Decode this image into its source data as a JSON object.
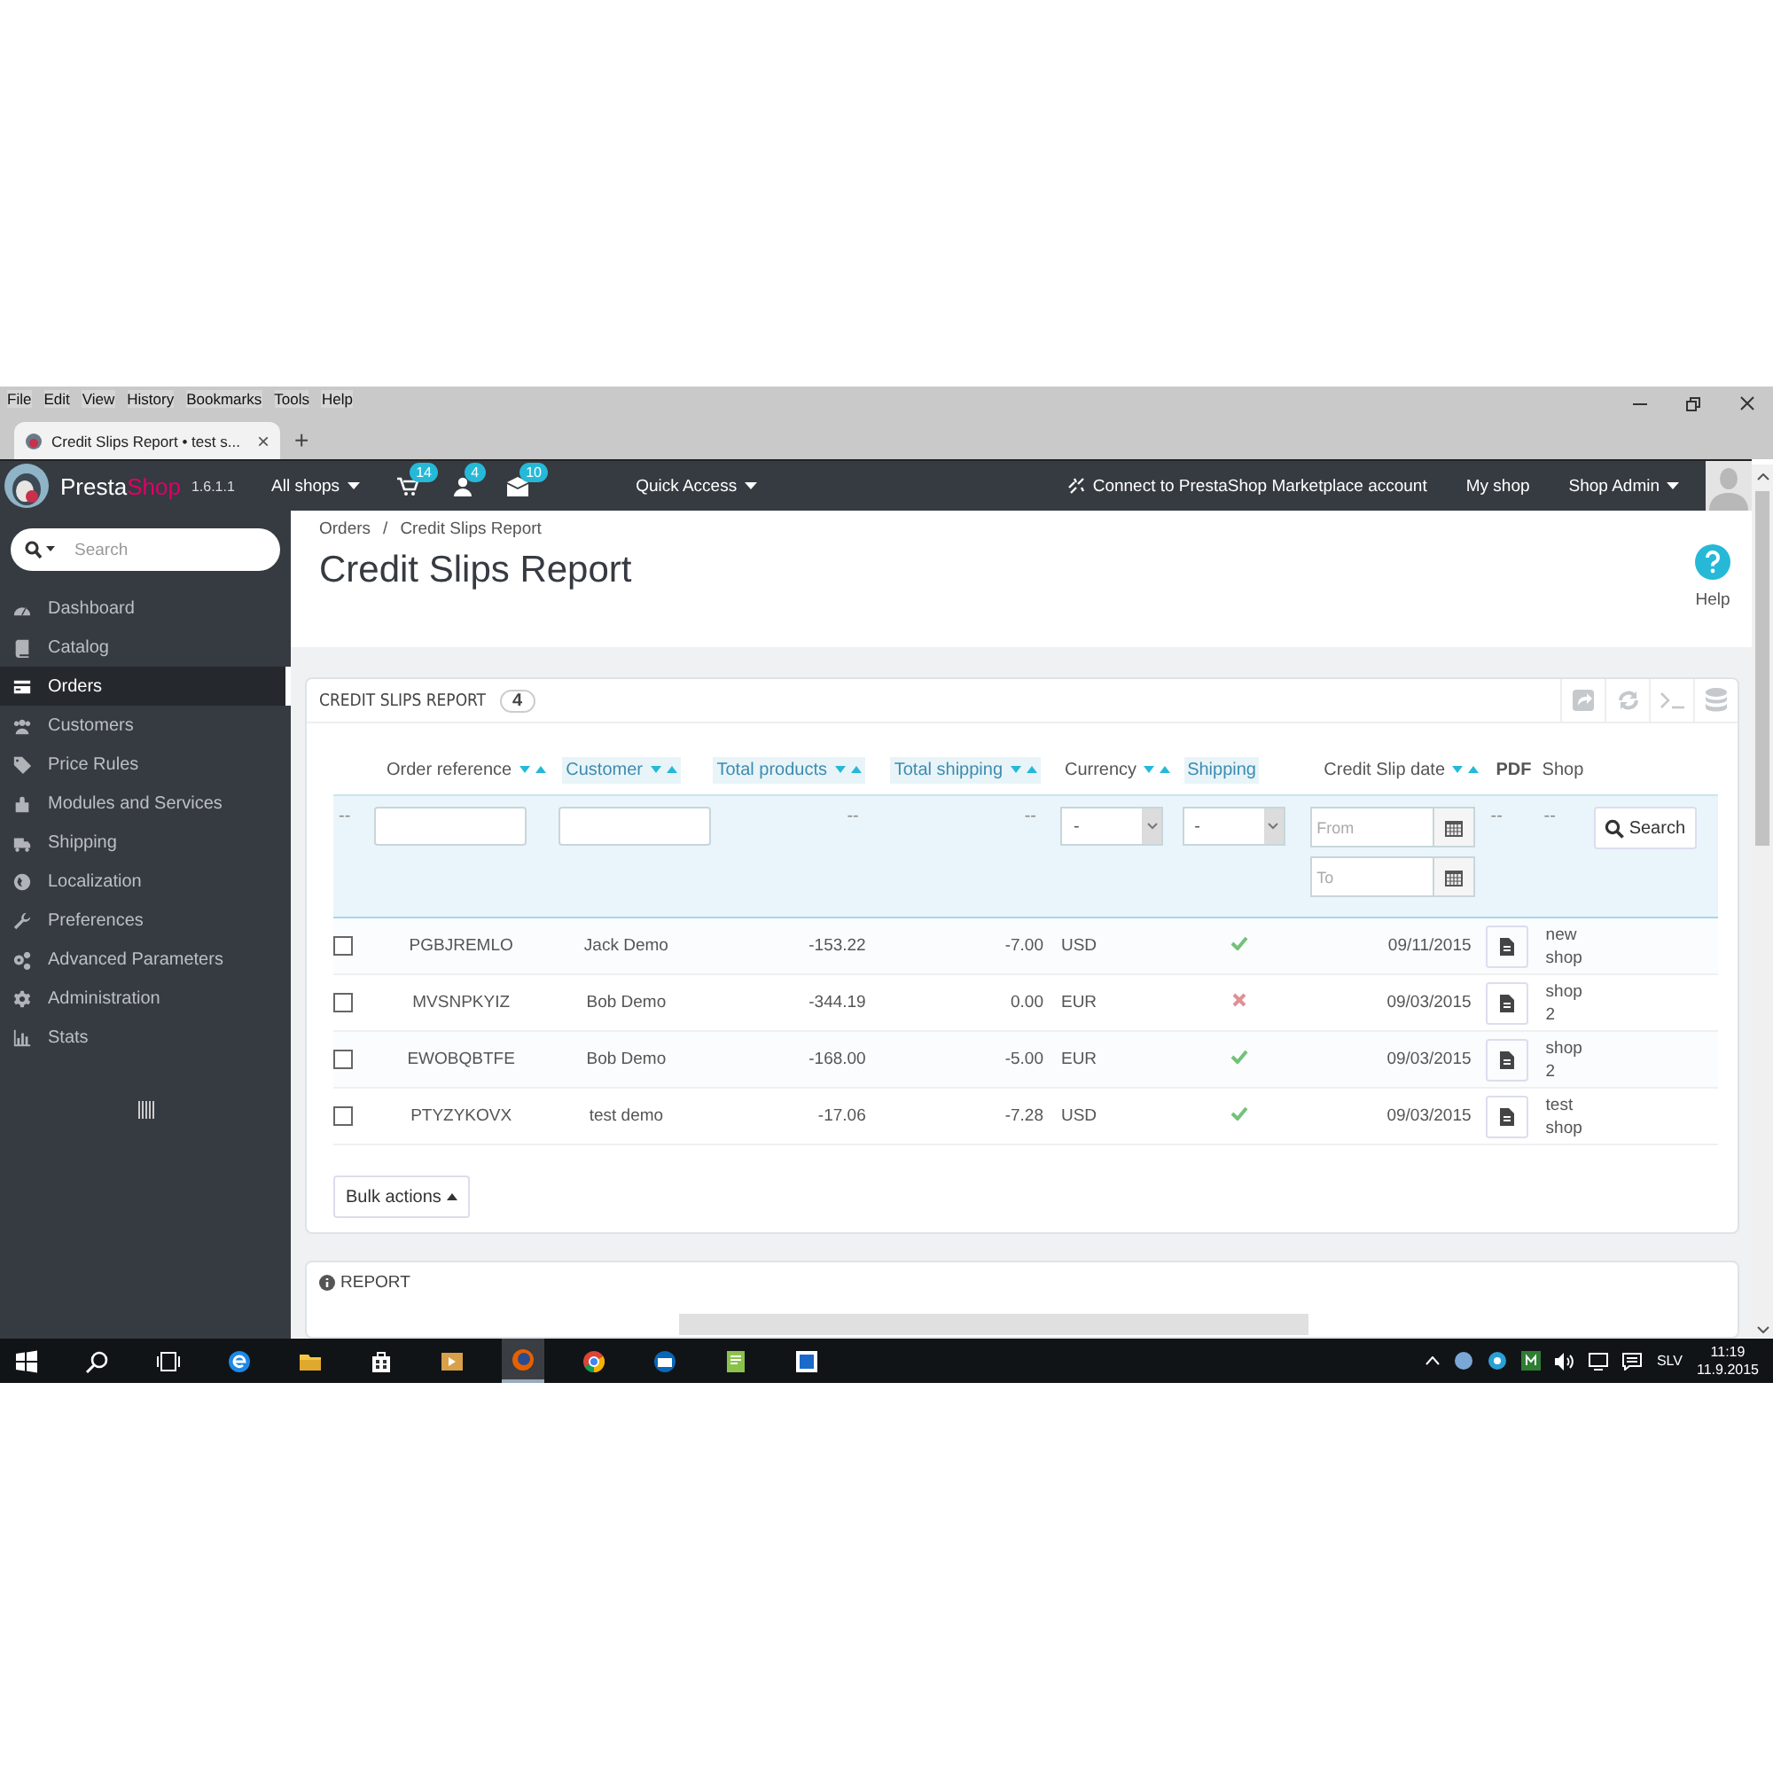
{
  "browser": {
    "menu": [
      "File",
      "Edit",
      "View",
      "History",
      "Bookmarks",
      "Tools",
      "Help"
    ],
    "tab": {
      "title": "Credit Slips Report • test s...",
      "close": "×"
    },
    "new_tab": "+"
  },
  "header": {
    "brand_a": "Presta",
    "brand_b": "Shop",
    "version": "1.6.1.1",
    "shop_selector": "All shops",
    "notifications": [
      {
        "kind": "cart",
        "count": "14"
      },
      {
        "kind": "customer",
        "count": "4"
      },
      {
        "kind": "message",
        "count": "10"
      }
    ],
    "quick_access": "Quick Access",
    "marketplace": "Connect to PrestaShop Marketplace account",
    "my_shop": "My shop",
    "user": "Shop Admin"
  },
  "sidebar": {
    "search_placeholder": "Search",
    "items": [
      {
        "label": "Dashboard",
        "kind": "dashboard",
        "selected": false
      },
      {
        "label": "Catalog",
        "kind": "catalog",
        "selected": false
      },
      {
        "label": "Orders",
        "kind": "orders",
        "selected": true
      },
      {
        "label": "Customers",
        "kind": "customers",
        "selected": false
      },
      {
        "label": "Price Rules",
        "kind": "price",
        "selected": false
      },
      {
        "label": "Modules and Services",
        "kind": "modules",
        "selected": false
      },
      {
        "label": "Shipping",
        "kind": "shipping",
        "selected": false
      },
      {
        "label": "Localization",
        "kind": "localization",
        "selected": false
      },
      {
        "label": "Preferences",
        "kind": "preferences",
        "selected": false
      },
      {
        "label": "Advanced Parameters",
        "kind": "advanced",
        "selected": false
      },
      {
        "label": "Administration",
        "kind": "administration",
        "selected": false
      },
      {
        "label": "Stats",
        "kind": "stats",
        "selected": false
      }
    ]
  },
  "page": {
    "breadcrumb": [
      "Orders",
      "Credit Slips Report"
    ],
    "separator": "/",
    "title": "Credit Slips Report",
    "help": "Help"
  },
  "panel": {
    "title": "CREDIT SLIPS REPORT",
    "count": "4",
    "columns": [
      {
        "label": "Order reference",
        "sortable": true,
        "highlighted": false,
        "bold": false
      },
      {
        "label": "Customer",
        "sortable": true,
        "highlighted": true,
        "bold": false
      },
      {
        "label": "Total products",
        "sortable": true,
        "highlighted": true,
        "bold": false
      },
      {
        "label": "Total shipping",
        "sortable": true,
        "highlighted": true,
        "bold": false
      },
      {
        "label": "Currency",
        "sortable": true,
        "highlighted": false,
        "bold": false
      },
      {
        "label": "Shipping",
        "sortable": false,
        "highlighted": true,
        "bold": false
      },
      {
        "label": "Credit Slip date",
        "sortable": true,
        "highlighted": false,
        "bold": false
      },
      {
        "label": "PDF",
        "sortable": false,
        "highlighted": false,
        "bold": true
      },
      {
        "label": "Shop",
        "sortable": false,
        "highlighted": false,
        "bold": false
      }
    ],
    "filters": [
      {
        "kind": "dash",
        "text": "--"
      },
      {
        "kind": "text"
      },
      {
        "kind": "text"
      },
      {
        "kind": "dash",
        "text": "--"
      },
      {
        "kind": "dash",
        "text": "--"
      },
      {
        "kind": "select",
        "value": "-"
      },
      {
        "kind": "select",
        "value": "-"
      },
      {
        "kind": "dates",
        "from": "From",
        "to": "To"
      },
      {
        "kind": "dash",
        "text": "--"
      },
      {
        "kind": "dash",
        "text": "--"
      },
      {
        "kind": "button",
        "label": "Search"
      }
    ],
    "rows": [
      {
        "checked": false,
        "reference": "PGBJREMLO",
        "customer": "Jack Demo",
        "total_products": "-153.22",
        "total_shipping": "-7.00",
        "currency": "USD",
        "shipping": true,
        "date": "09/11/2015",
        "shop": "new shop"
      },
      {
        "checked": false,
        "reference": "MVSNPKYIZ",
        "customer": "Bob Demo",
        "total_products": "-344.19",
        "total_shipping": "0.00",
        "currency": "EUR",
        "shipping": false,
        "date": "09/03/2015",
        "shop": "shop 2"
      },
      {
        "checked": false,
        "reference": "EWOBQBTFE",
        "customer": "Bob Demo",
        "total_products": "-168.00",
        "total_shipping": "-5.00",
        "currency": "EUR",
        "shipping": true,
        "date": "09/03/2015",
        "shop": "shop 2"
      },
      {
        "checked": false,
        "reference": "PTYZYKOVX",
        "customer": "test demo",
        "total_products": "-17.06",
        "total_shipping": "-7.28",
        "currency": "USD",
        "shipping": true,
        "date": "09/03/2015",
        "shop": "test shop"
      }
    ],
    "bulk_actions": "Bulk actions"
  },
  "report_panel": {
    "title": "REPORT"
  },
  "taskbar": {
    "apps": [
      {
        "kind": "start",
        "selected": false
      },
      {
        "kind": "search",
        "selected": false
      },
      {
        "kind": "taskview",
        "selected": false
      },
      {
        "kind": "edge",
        "selected": false
      },
      {
        "kind": "explorer",
        "selected": false
      },
      {
        "kind": "store",
        "selected": false
      },
      {
        "kind": "media",
        "selected": false
      },
      {
        "kind": "firefox",
        "selected": true
      },
      {
        "kind": "chrome",
        "selected": false
      },
      {
        "kind": "mail",
        "selected": false
      },
      {
        "kind": "notepad",
        "selected": false
      },
      {
        "kind": "remote",
        "selected": false
      }
    ],
    "language": "SLV",
    "time": "11:19",
    "date": "11.9.2015"
  }
}
